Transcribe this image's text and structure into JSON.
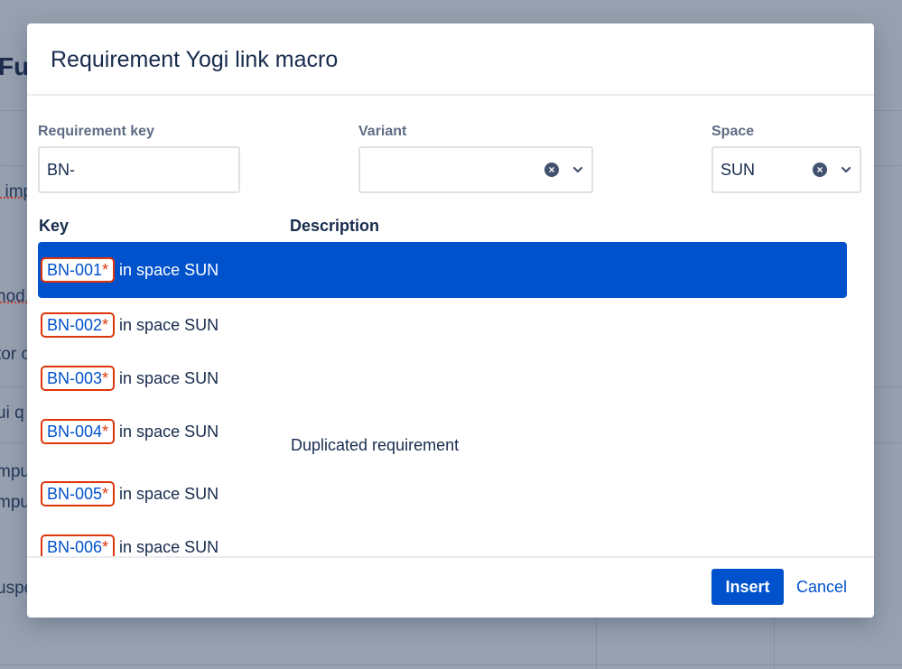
{
  "background": {
    "page_title": "Fu",
    "text_fragments": [
      "i imp",
      "nod.",
      "tor c",
      "ui q",
      "mpu",
      "mpu",
      "uspe"
    ]
  },
  "dialog": {
    "title": "Requirement Yogi link macro",
    "fields": {
      "requirement_key": {
        "label": "Requirement key",
        "value": "BN-"
      },
      "variant": {
        "label": "Variant",
        "value": ""
      },
      "space": {
        "label": "Space",
        "value": "SUN"
      }
    },
    "columns": {
      "key": "Key",
      "description": "Description"
    },
    "results": [
      {
        "key": "BN-001",
        "marker": "*",
        "space_text": "in space SUN",
        "description": "",
        "selected": true
      },
      {
        "key": "BN-002",
        "marker": "*",
        "space_text": "in space SUN",
        "description": ""
      },
      {
        "key": "BN-003",
        "marker": "*",
        "space_text": "in space SUN",
        "description": ""
      },
      {
        "key": "BN-004",
        "marker": "*",
        "space_text": "in space SUN",
        "description": "Duplicated requirement"
      },
      {
        "key": "BN-005",
        "marker": "*",
        "space_text": "in space SUN",
        "description": ""
      },
      {
        "key": "BN-006",
        "marker": "*",
        "space_text": "in space SUN",
        "description": ""
      }
    ],
    "footer": {
      "insert_label": "Insert",
      "cancel_label": "Cancel"
    },
    "icons": {
      "clear": "clear-icon",
      "dropdown": "chevron-down-icon"
    },
    "colors": {
      "primary": "#0052cc",
      "key_border": "#de350b",
      "overlay": "#97a0af"
    }
  }
}
